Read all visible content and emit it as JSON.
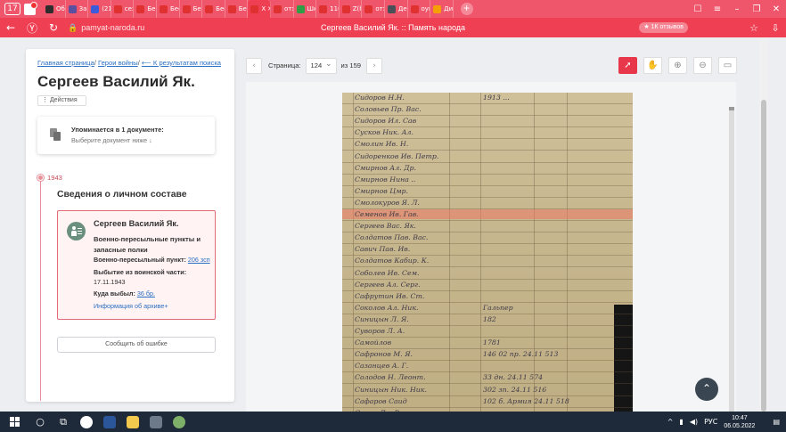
{
  "browser": {
    "tab_counter": "17",
    "tabs": [
      {
        "label": "Об",
        "color": "#2d2d2d"
      },
      {
        "label": "Зап",
        "color": "#5b4fa0"
      },
      {
        "label": "(21",
        "color": "#3b5bdb"
      },
      {
        "label": "сез",
        "color": "#e03131"
      },
      {
        "label": "Бес",
        "color": "#e03131"
      },
      {
        "label": "Бес",
        "color": "#e03131"
      },
      {
        "label": "Бес",
        "color": "#e03131"
      },
      {
        "label": "Бес",
        "color": "#e03131"
      },
      {
        "label": "Бес",
        "color": "#e03131"
      },
      {
        "label": "Х",
        "color": "#e03131",
        "active": true
      },
      {
        "label": "отз",
        "color": "#e03131"
      },
      {
        "label": "Шк",
        "color": "#2f9e44"
      },
      {
        "label": "11(",
        "color": "#e03131"
      },
      {
        "label": "Z(h",
        "color": "#e03131"
      },
      {
        "label": "отз",
        "color": "#e03131"
      },
      {
        "label": "Де",
        "color": "#495057"
      },
      {
        "label": "оуп",
        "color": "#e03131"
      },
      {
        "label": "Ди",
        "color": "#f59f00"
      }
    ],
    "url": "pamyat-naroda.ru",
    "page_title": "Сергеев Василий Як. :: Память народа",
    "reviews_badge": "★ 1К отзывов"
  },
  "profile": {
    "breadcrumb": {
      "home": "Главная страница",
      "heroes": "Герои войны",
      "back": "⟵ К результатам поиска"
    },
    "name": "Сергеев Василий Як.",
    "actions_label": "⋮ Действия",
    "mention": {
      "title": "Упоминается в 1 документе:",
      "subtitle": "Выберите документ ниже ↓"
    },
    "year": "1943",
    "section_title": "Сведения о личном составе",
    "record": {
      "name": "Сергеев Василий Як.",
      "unit": "Военно-пересыльные пункты и запасные полки",
      "transit_label": "Военно-пересыльный пункт:",
      "transit_value": "206 зсп",
      "departure_label": "Выбытие из воинской части:",
      "departure_date": "17.11.1943",
      "dest_label": "Куда выбыл:",
      "dest_value": "36 бр.",
      "archive_link": "Информация об архиве+"
    },
    "report_button": "Сообщить об ошибке"
  },
  "viewer": {
    "page_label": "Страница:",
    "page_current": "124",
    "page_total": "из 159",
    "document_lines": [
      {
        "name": "Сидоров Н.Н.",
        "extra": "1913 ..."
      },
      {
        "name": "Соловьев Пр. Вас.",
        "extra": ""
      },
      {
        "name": "Сидоров Ил. Сав",
        "extra": ""
      },
      {
        "name": "Сусков Ник. Ал.",
        "extra": ""
      },
      {
        "name": "Смолин Ив. Н.",
        "extra": ""
      },
      {
        "name": "Сидоренков Ив. Петр.",
        "extra": ""
      },
      {
        "name": "Смирнов Ал. Др.",
        "extra": ""
      },
      {
        "name": "Смирнов Нина ..",
        "extra": ""
      },
      {
        "name": "Смирнов Цмр.",
        "extra": ""
      },
      {
        "name": "Смолокуров Я. Л.",
        "extra": ""
      },
      {
        "name": "Семенов Ив. Гав.",
        "extra": ""
      },
      {
        "name": "Сергеев Вас. Як.",
        "extra": ""
      },
      {
        "name": "Солдатов Пав. Вас.",
        "extra": ""
      },
      {
        "name": "Савич Пав. Ив.",
        "extra": ""
      },
      {
        "name": "Солдатов Кабир. К.",
        "extra": ""
      },
      {
        "name": "Соболев Ив. Сем.",
        "extra": ""
      },
      {
        "name": "Сергеев Ал. Серг.",
        "extra": ""
      },
      {
        "name": "Сафрутин Ив. Ст.",
        "extra": ""
      },
      {
        "name": "Соколов Ал. Ник.",
        "extra": "Гальпер"
      },
      {
        "name": "Синицын Л. Я.",
        "extra": "182"
      },
      {
        "name": "Суворов Л. А.",
        "extra": ""
      },
      {
        "name": "Самойлов",
        "extra": "1781"
      },
      {
        "name": "Сафронов М. Я.",
        "extra": "146 02 пр. 24.11 513"
      },
      {
        "name": "Сазанцев А. Г.",
        "extra": ""
      },
      {
        "name": "Солодов Н. Леонт.",
        "extra": "33 дн. 24.11 574"
      },
      {
        "name": "Синицын Ник. Ник.",
        "extra": "302 зп. 24.11 516"
      },
      {
        "name": "Сафаров Саид",
        "extra": "102 б. Армия 24.11 518"
      },
      {
        "name": "Сурин Ди. Ви.",
        "extra": ""
      },
      {
        "name": "Смолов Ал. др. Ку.",
        "extra": ""
      }
    ]
  },
  "taskbar": {
    "lang": "РУС",
    "time": "10:47",
    "date": "06.05.2022"
  }
}
